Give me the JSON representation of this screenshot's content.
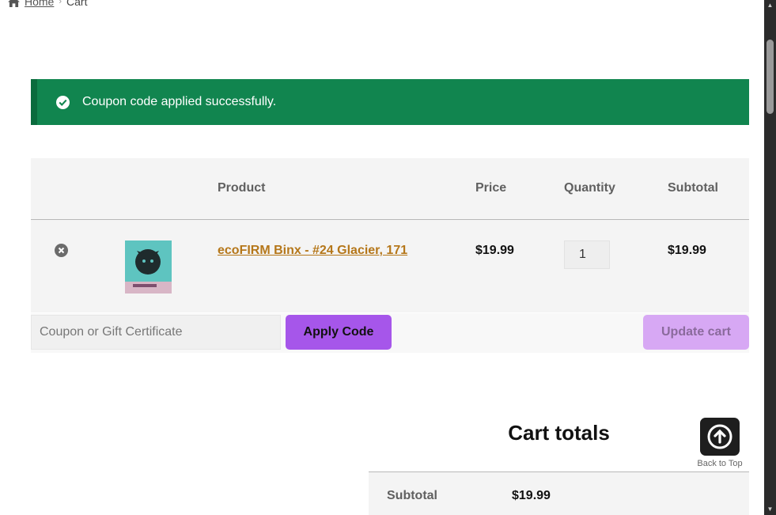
{
  "breadcrumb": {
    "home": "Home",
    "current": "Cart"
  },
  "notice": {
    "message": "Coupon code applied successfully.",
    "color": "#11854f"
  },
  "cart_table": {
    "headers": {
      "product": "Product",
      "price": "Price",
      "quantity": "Quantity",
      "subtotal": "Subtotal"
    },
    "items": [
      {
        "product_name": "ecoFIRM Binx - #24 Glacier, 171",
        "price": "$19.99",
        "quantity": "1",
        "subtotal": "$19.99"
      }
    ]
  },
  "actions": {
    "coupon_placeholder": "Coupon or Gift Certificate",
    "apply_label": "Apply Code",
    "update_label": "Update cart",
    "accent_color": "#a656ea"
  },
  "totals": {
    "title": "Cart totals",
    "subtotal_label": "Subtotal",
    "subtotal_value": "$19.99"
  },
  "back_to_top": {
    "label": "Back to Top"
  },
  "icons": [
    "home-icon",
    "chevron-right-icon",
    "check-circle-icon",
    "remove-icon",
    "arrow-up-icon"
  ]
}
